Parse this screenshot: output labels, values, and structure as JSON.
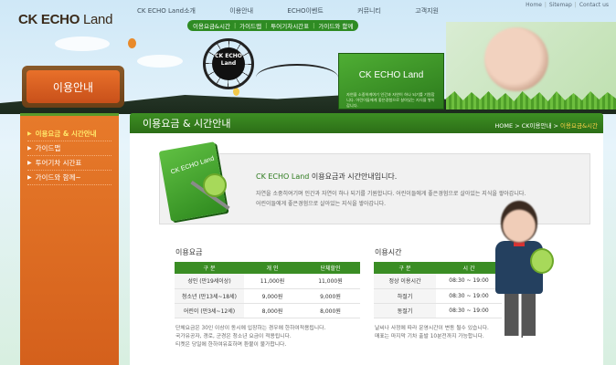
{
  "header": {
    "logo_main": "CK ECHO",
    "logo_land": " Land",
    "top_links": [
      "Home",
      "Sitemap",
      "Contact us"
    ],
    "gnb": [
      "CK ECHO Land소개",
      "이용안내",
      "ECHO이벤트",
      "커뮤니티",
      "고객지원"
    ],
    "subnav": [
      "이용요금&시간",
      "가이드맵",
      "투어기차시간표",
      "가이드와 함께"
    ],
    "wheel_label": "CK ECHO Land",
    "banner_title": "CK ECHO Land",
    "banner_desc": "자연을 소중하게여기 인간과 자연이 하나 되기를 기원합니다. 어린이들에게 좋은경험으로 살아있는 지식을 쌓아갑니다."
  },
  "sidebar": {
    "sign": "이용안내",
    "items": [
      {
        "label": "이용요금 & 시간안내",
        "active": true
      },
      {
        "label": "가이드맵",
        "active": false
      },
      {
        "label": "투어기차 시간표",
        "active": false
      },
      {
        "label": "가이드와 함께~",
        "active": false
      }
    ]
  },
  "main": {
    "title": "이용요금 & 시간안내",
    "breadcrumb": [
      "HOME",
      "CK이용안내",
      "이용요금&시간"
    ],
    "intro": {
      "book_label": "CK ECHO Land",
      "title_prefix": "CK ECHO Land ",
      "title_rest": "이용요금과 시간안내입니다.",
      "lines": [
        "자연을 소중히여기며 인간과 자연이 하나 되기를 기원합니다. 어린이들에게 좋은경험으로 살아있는 지식을 쌓아갑니다.",
        "어린이들에게 좋은경험으로 살아있는 지식을 쌓아갑니다."
      ]
    },
    "fees": {
      "title": "이용요금",
      "headers": [
        "구 분",
        "개 인",
        "단체할인"
      ],
      "rows": [
        [
          "성인 (만19세이상)",
          "11,000원",
          "11,000원"
        ],
        [
          "청소년 (만13세~18세)",
          "9,000원",
          "9,000원"
        ],
        [
          "어린이 (만3세~12세)",
          "8,000원",
          "8,000원"
        ]
      ],
      "notes": [
        "단체요금은 30인 이상이 동시에 입장하는 경우에 한하여적용됩니다.",
        "국가유공자, 경로, 군경은 청소년 요금이 적용됩니다.",
        "티켓은 당일에 한하여유효하며 환불이 불가합니다."
      ]
    },
    "hours": {
      "title": "이용시간",
      "headers": [
        "구 분",
        "시 간"
      ],
      "rows": [
        [
          "정상 이용시간",
          "08:30 ~ 19:00"
        ],
        [
          "하절기",
          "08:30 ~ 19:00"
        ],
        [
          "동절기",
          "08:30 ~ 19:00"
        ]
      ],
      "notes": [
        "날씨나 사정에 따라 운영시간이 변동 될수 있습니다.",
        "매표는 마지막 기차 출발 10분전까지 가능합니다."
      ]
    }
  }
}
